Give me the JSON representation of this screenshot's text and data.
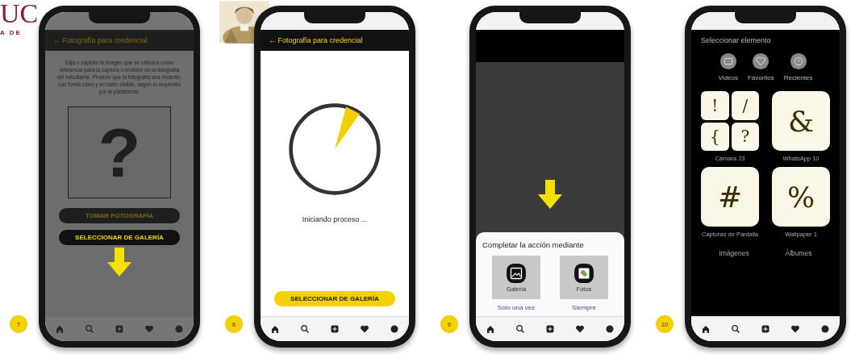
{
  "logo": {
    "text": "UC",
    "subtitle": "A DE"
  },
  "phones": [
    {
      "kind": "upload",
      "step": "7",
      "dimmed": true,
      "header": "← Fotografía para credencial",
      "instructions": "Elija o capture la imagen que se utilizará como referencia para la captura o revisión de la fotografía del estudiante. Procure que la fotografía sea reciente, con fondo claro y el rostro visible, según lo requerido por la plataforma.",
      "placeholder_symbol": "?",
      "arrow": true,
      "buttons": [
        {
          "label": "TOMAR FOTOGRAFÍA",
          "highlighted": false
        },
        {
          "label": "SELECCIONAR DE GALERÍA",
          "highlighted": true
        }
      ]
    },
    {
      "kind": "loading",
      "step": "8",
      "dimmed": false,
      "header": "← Fotografía para credencial",
      "status": "Iniciando proceso ...",
      "buttons": [
        {
          "label": "SELECCIONAR DE GALERÍA",
          "highlighted": true
        }
      ]
    },
    {
      "kind": "chooser",
      "step": "9",
      "dimmed": false,
      "arrow": true,
      "sheet": {
        "title": "Completar la acción mediante",
        "apps": [
          {
            "name": "Galería",
            "kind": "gallery"
          },
          {
            "name": "Fotos",
            "kind": "photos"
          }
        ],
        "actions": [
          "Solo una vez",
          "Siempre"
        ]
      }
    },
    {
      "kind": "picker",
      "step": "10",
      "dimmed": false,
      "title": "Seleccionar elemento",
      "shortcuts": [
        {
          "label": "Videos",
          "kind": "video"
        },
        {
          "label": "Favoritos",
          "kind": "heart"
        },
        {
          "label": "Recientes",
          "kind": "clock"
        }
      ],
      "albums": [
        {
          "symbols": [
            "!",
            "/",
            "{",
            "?"
          ],
          "name": "Cámara 23"
        },
        {
          "symbols": [
            "&"
          ],
          "name": "WhatsApp 10"
        },
        {
          "symbols": [
            "#"
          ],
          "name": "Capturas de Pantalla"
        },
        {
          "symbols": [
            "%"
          ],
          "name": "Wallpaper 1"
        }
      ],
      "tabs": [
        "Imágenes",
        "Álbumes"
      ]
    }
  ]
}
